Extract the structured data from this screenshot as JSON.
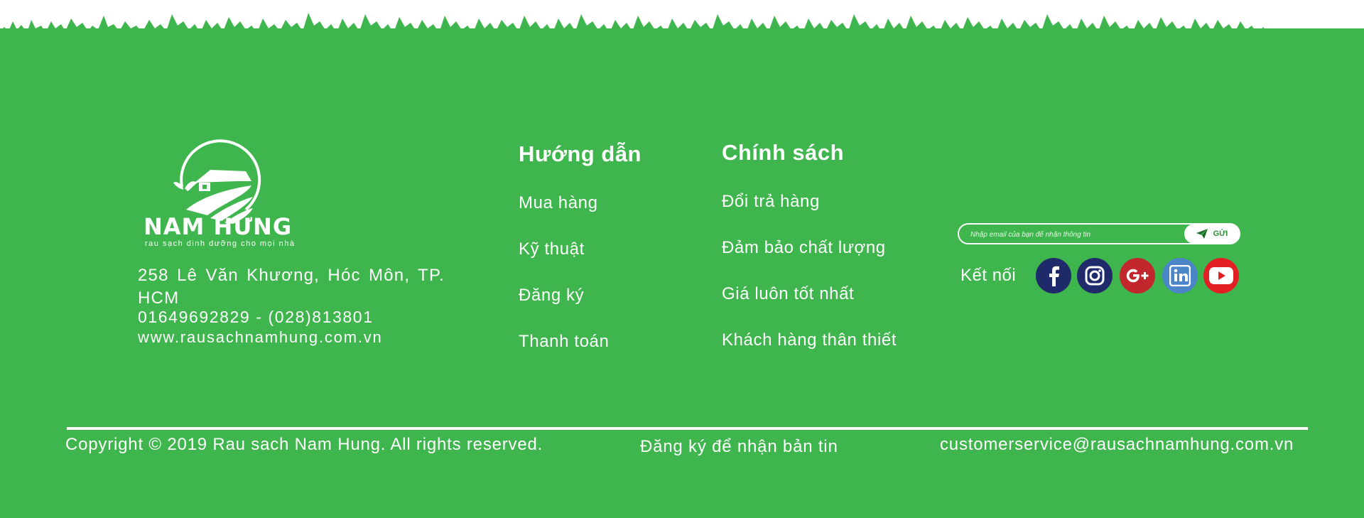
{
  "brand": {
    "name": "NAM HƯNG",
    "tagline": "rau sạch dinh dưỡng cho mọi nhà"
  },
  "contact": {
    "address": "258 Lê Văn Khương, Hóc Môn, TP. HCM",
    "phone": "01649692829 - (028)813801",
    "website": "www.rausachnamhung.com.vn"
  },
  "guide": {
    "title": "Hướng dẫn",
    "links": [
      "Mua hàng",
      "Kỹ thuật",
      "Đăng ký",
      "Thanh toán"
    ]
  },
  "policy": {
    "title": "Chính sách",
    "links": [
      "Đổi trả hàng",
      "Đảm bảo chất lượng",
      "Giá luôn tốt nhất",
      "Khách hàng thân thiết"
    ]
  },
  "newsletter": {
    "placeholder": "Nhập email của bạn để nhận thông tin",
    "button_label": "GỬI"
  },
  "connect": {
    "label": "Kết nối",
    "networks": [
      {
        "icon": "facebook-icon",
        "color": "#1f2a6b"
      },
      {
        "icon": "instagram-icon",
        "color": "#1f2a6b"
      },
      {
        "icon": "google-plus-icon",
        "color": "#c2272d"
      },
      {
        "icon": "linkedin-icon",
        "color": "#4a86c8"
      },
      {
        "icon": "youtube-icon",
        "color": "#e31e24"
      }
    ]
  },
  "bottom": {
    "copyright": "Copyright © 2019 Rau sach Nam Hung. All rights reserved.",
    "subscribe": "Đăng ký để nhận bản tin",
    "email": "customerservice@rausachnamhung.com.vn"
  },
  "colors": {
    "footer_green": "#3fb54d",
    "white": "#ffffff"
  }
}
